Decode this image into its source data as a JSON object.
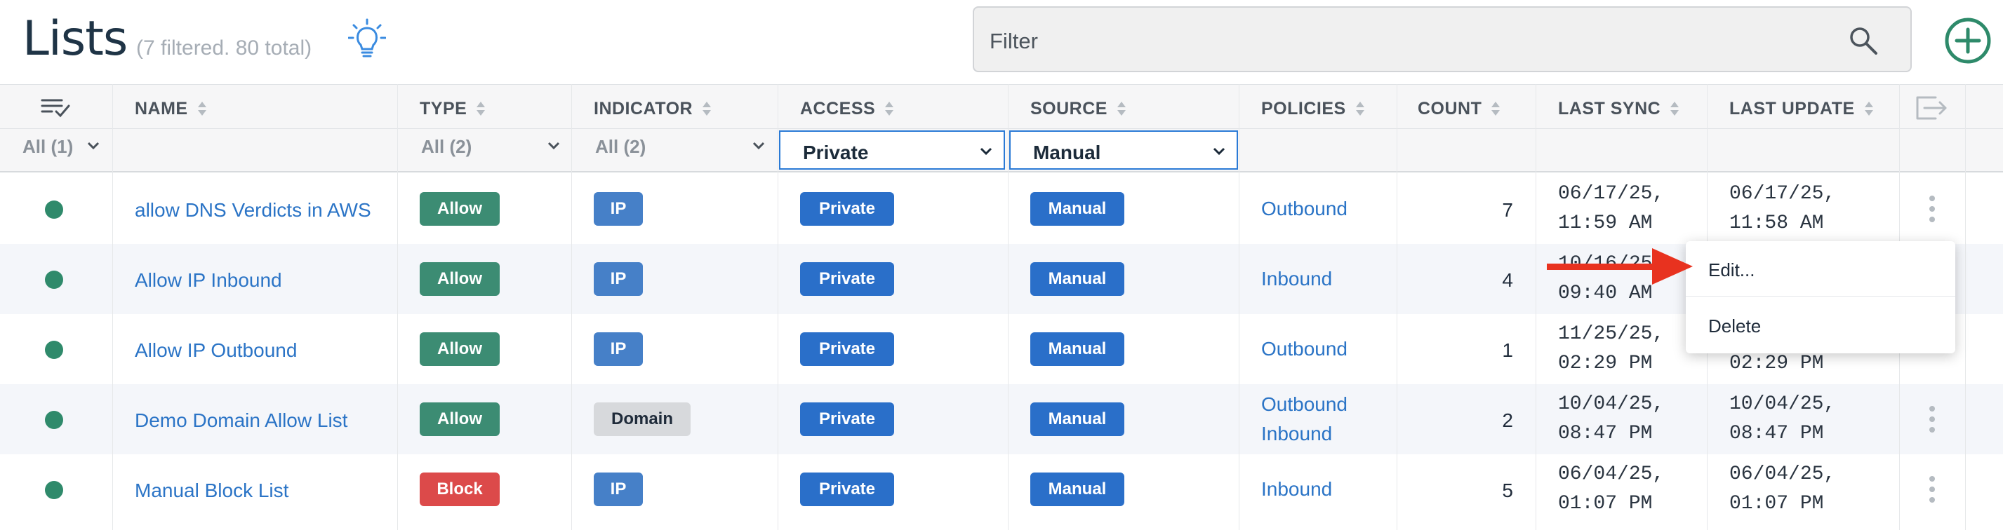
{
  "header": {
    "title": "Lists",
    "subtitle": "(7 filtered. 80 total)",
    "filter_placeholder": "Filter",
    "icons": {
      "hint": "lightbulb-icon",
      "search": "search-icon",
      "add": "add-circle-icon"
    }
  },
  "colors": {
    "accent": "#2a6fc9",
    "allow": "#3c8c73",
    "block": "#dc4a4a",
    "ip": "#4680c8",
    "status_dot": "#2f8a6b",
    "link": "#2b74c6"
  },
  "columns": {
    "name": "NAME",
    "type": "TYPE",
    "indicator": "INDICATOR",
    "access": "ACCESS",
    "source": "SOURCE",
    "policies": "POLICIES",
    "count": "COUNT",
    "last_sync": "LAST SYNC",
    "last_update": "LAST UPDATE"
  },
  "filters": {
    "status": "All (1)",
    "type": "All (2)",
    "indicator": "All (2)",
    "access": "Private",
    "source": "Manual"
  },
  "rows": [
    {
      "name": "allow DNS Verdicts in AWS",
      "type": "Allow",
      "indicator": "IP",
      "access": "Private",
      "source": "Manual",
      "policies": [
        "Outbound"
      ],
      "count": "7",
      "last_sync": [
        "06/17/25,",
        "11:59 AM"
      ],
      "last_update": [
        "06/17/25,",
        "11:58 AM"
      ]
    },
    {
      "name": "Allow IP Inbound",
      "type": "Allow",
      "indicator": "IP",
      "access": "Private",
      "source": "Manual",
      "policies": [
        "Inbound"
      ],
      "count": "4",
      "last_sync": [
        "10/16/25,",
        "09:40 AM"
      ],
      "last_update": [
        "",
        ""
      ]
    },
    {
      "name": "Allow IP Outbound",
      "type": "Allow",
      "indicator": "IP",
      "access": "Private",
      "source": "Manual",
      "policies": [
        "Outbound"
      ],
      "count": "1",
      "last_sync": [
        "11/25/25,",
        "02:29 PM"
      ],
      "last_update": [
        "",
        "02:29 PM"
      ]
    },
    {
      "name": "Demo Domain Allow List",
      "type": "Allow",
      "indicator": "Domain",
      "access": "Private",
      "source": "Manual",
      "policies": [
        "Outbound",
        "Inbound"
      ],
      "count": "2",
      "last_sync": [
        "10/04/25,",
        "08:47 PM"
      ],
      "last_update": [
        "10/04/25,",
        "08:47 PM"
      ]
    },
    {
      "name": "Manual Block List",
      "type": "Block",
      "indicator": "IP",
      "access": "Private",
      "source": "Manual",
      "policies": [
        "Inbound"
      ],
      "count": "5",
      "last_sync": [
        "06/04/25,",
        "01:07 PM"
      ],
      "last_update": [
        "06/04/25,",
        "01:07 PM"
      ]
    }
  ],
  "context_menu": {
    "edit": "Edit...",
    "delete": "Delete"
  }
}
